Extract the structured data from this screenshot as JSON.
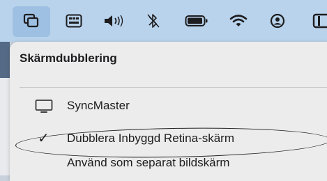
{
  "menubar": {
    "icons": [
      "mirror-display-icon",
      "keyboard-input-icon",
      "speaker-icon",
      "bluetooth-icon",
      "battery-icon",
      "wifi-icon",
      "user-icon",
      "partial-icon"
    ]
  },
  "menu": {
    "title": "Skärmdubblering",
    "items": [
      {
        "label": "SyncMaster",
        "icon": "display-icon",
        "checked": false
      },
      {
        "label": "Dubblera Inbyggd Retina-skärm",
        "icon": "",
        "checked": true
      },
      {
        "label": "Använd som separat bildskärm",
        "icon": "",
        "checked": false
      }
    ],
    "check_glyph": "✓"
  }
}
